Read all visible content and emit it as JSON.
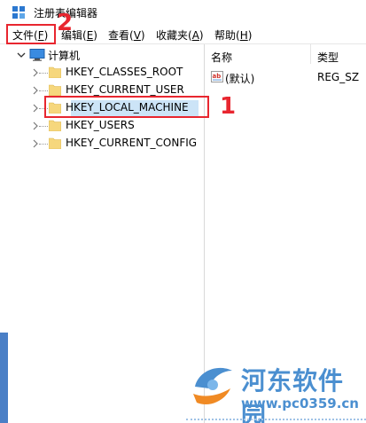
{
  "window": {
    "title": "注册表编辑器"
  },
  "menu": {
    "file": {
      "text": "文件(",
      "key": "F",
      "close": ")"
    },
    "edit": {
      "text": "编辑(",
      "key": "E",
      "close": ")"
    },
    "view": {
      "text": "查看(",
      "key": "V",
      "close": ")"
    },
    "favorites": {
      "text": "收藏夹(",
      "key": "A",
      "close": ")"
    },
    "help": {
      "text": "帮助(",
      "key": "H",
      "close": ")"
    }
  },
  "tree": {
    "root": "计算机",
    "nodes": [
      {
        "label": "HKEY_CLASSES_ROOT"
      },
      {
        "label": "HKEY_CURRENT_USER"
      },
      {
        "label": "HKEY_LOCAL_MACHINE",
        "selected": true
      },
      {
        "label": "HKEY_USERS"
      },
      {
        "label": "HKEY_CURRENT_CONFIG"
      }
    ]
  },
  "list": {
    "columns": {
      "name": "名称",
      "type": "类型"
    },
    "rows": [
      {
        "name": "(默认)",
        "type": "REG_SZ",
        "icon": "ab-string-icon"
      }
    ]
  },
  "annotations": {
    "one": "1",
    "two": "2"
  },
  "watermark": {
    "name": "河东软件园",
    "url": "www.pc0359.cn"
  },
  "colors": {
    "annotation": "#e8262f",
    "selection": "#cce4f7",
    "folder": "#f6d77d",
    "watermark": "#4b8fd0"
  }
}
